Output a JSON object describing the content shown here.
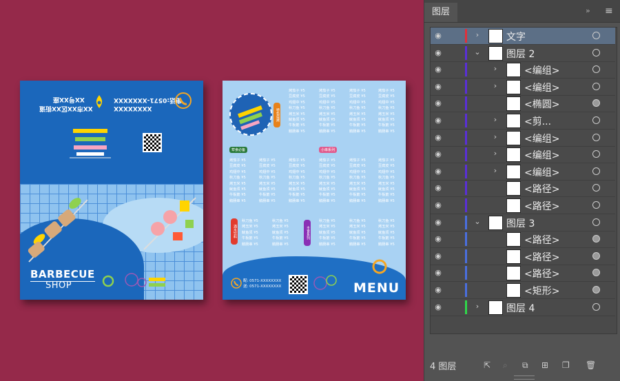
{
  "left_flyer": {
    "upside_address": "XX市XX区XX街道",
    "upside_number": "XX号XX座",
    "upside_tel1": "电话:0571-XXXXXXX",
    "upside_tel2": "XXXXXXXX",
    "upside_tel3": "XXXXXXXX",
    "title": "BARBECUE",
    "subtitle": "SHOP"
  },
  "right_flyer": {
    "menu_title": "MENU",
    "contact_line1": "配: 0571-XXXXXXXX",
    "contact_line2": "送: 0571-XXXXXXXX",
    "pill_meat": "荤食必备",
    "pill_snack": "小串系列",
    "badge_special": "特色烧烤",
    "badge_drink": "酒水饮料",
    "badge_staple": "主食系列",
    "menu_block1": [
      "烤茄子 ¥5",
      "豆腐皮 ¥5",
      "鸡翅中 ¥5",
      "秋刀鱼 ¥5",
      "烤玉米 ¥5",
      "鱿鱼须 ¥5",
      "牛板筋 ¥5",
      "鹅肠串 ¥5"
    ],
    "menu_block2": [
      "烤茄子 ¥5",
      "豆腐皮 ¥5",
      "鸡翅中 ¥5",
      "秋刀鱼 ¥5",
      "烤玉米 ¥5",
      "鱿鱼须 ¥5",
      "牛板筋 ¥5",
      "鹅肠串 ¥5"
    ],
    "menu_block3": [
      "秋刀鱼 ¥5",
      "烤玉米 ¥5",
      "鱿鱼须 ¥5",
      "牛板筋 ¥5",
      "鹅肠串 ¥5"
    ]
  },
  "layers_panel": {
    "tab_title": "图层",
    "collapse_icon": "»",
    "layer_count": "4 图层",
    "rows": [
      {
        "name": "文字",
        "indent": 0,
        "twisty": "›",
        "color": "#e0303a",
        "selected": true,
        "target_filled": false
      },
      {
        "name": "图层 2",
        "indent": 0,
        "twisty": "⌄",
        "color": "#5a2fd8",
        "selected": false,
        "target_filled": false
      },
      {
        "name": "<编组>",
        "indent": 1,
        "twisty": "›",
        "color": "#5a2fd8",
        "selected": false,
        "target_filled": false
      },
      {
        "name": "<编组>",
        "indent": 1,
        "twisty": "›",
        "color": "#5a2fd8",
        "selected": false,
        "target_filled": false
      },
      {
        "name": "<椭圆>",
        "indent": 1,
        "twisty": "",
        "color": "#5a2fd8",
        "selected": false,
        "target_filled": true
      },
      {
        "name": "<剪...",
        "indent": 1,
        "twisty": "›",
        "color": "#5a2fd8",
        "selected": false,
        "target_filled": false
      },
      {
        "name": "<编组>",
        "indent": 1,
        "twisty": "›",
        "color": "#5a2fd8",
        "selected": false,
        "target_filled": false
      },
      {
        "name": "<编组>",
        "indent": 1,
        "twisty": "›",
        "color": "#5a2fd8",
        "selected": false,
        "target_filled": false
      },
      {
        "name": "<编组>",
        "indent": 1,
        "twisty": "›",
        "color": "#5a2fd8",
        "selected": false,
        "target_filled": false
      },
      {
        "name": "<路径>",
        "indent": 1,
        "twisty": "",
        "color": "#5a2fd8",
        "selected": false,
        "target_filled": false
      },
      {
        "name": "<路径>",
        "indent": 1,
        "twisty": "",
        "color": "#5a2fd8",
        "selected": false,
        "target_filled": false
      },
      {
        "name": "图层 3",
        "indent": 0,
        "twisty": "⌄",
        "color": "#4a6fe0",
        "selected": false,
        "target_filled": false
      },
      {
        "name": "<路径>",
        "indent": 1,
        "twisty": "",
        "color": "#4a6fe0",
        "selected": false,
        "target_filled": true
      },
      {
        "name": "<路径>",
        "indent": 1,
        "twisty": "",
        "color": "#4a6fe0",
        "selected": false,
        "target_filled": true
      },
      {
        "name": "<路径>",
        "indent": 1,
        "twisty": "",
        "color": "#4a6fe0",
        "selected": false,
        "target_filled": true
      },
      {
        "name": "<矩形>",
        "indent": 1,
        "twisty": "",
        "color": "#4a6fe0",
        "selected": false,
        "target_filled": true
      },
      {
        "name": "图层 4",
        "indent": 0,
        "twisty": "›",
        "color": "#2fd84a",
        "selected": false,
        "target_filled": false
      }
    ]
  }
}
